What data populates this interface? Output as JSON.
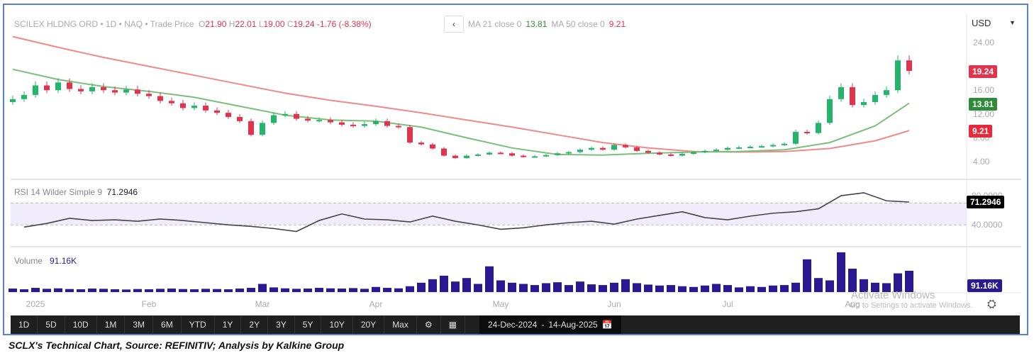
{
  "header": {
    "title": "SCILEX HLDNG ORD",
    "interval": "1D",
    "exchange": "NAQ",
    "price_type": "Trade Price",
    "open_label": "O",
    "open": "21.90",
    "high_label": "H",
    "high": "22.01",
    "low_label": "L",
    "low": "19.00",
    "close_label": "C",
    "close": "19.24",
    "change": "-1.76 (-8.38%)"
  },
  "ma_legend": {
    "ma21_label": "MA 21 close 0",
    "ma21_value": "13.81",
    "ma50_label": "MA 50 close 0",
    "ma50_value": "9.21"
  },
  "currency": "USD",
  "rsi_legend": {
    "label": "RSI 14 Wilder Simple 9",
    "value": "71.2946"
  },
  "volume_legend": {
    "label": "Volume",
    "value": "91.16K"
  },
  "tags": {
    "last_price": "19.24",
    "ma21": "13.81",
    "ma50": "9.21",
    "rsi": "71.2946",
    "volume": "91.16K"
  },
  "colors": {
    "up": "#26b36b",
    "down": "#e0344e",
    "ma21": "#7bbf7b",
    "ma50": "#f08a8a",
    "rsi": "#444444",
    "volume": "#2b1a8f",
    "rsi_band": "#f1ecfb"
  },
  "toolbar": {
    "ranges": [
      "1D",
      "5D",
      "10D",
      "1M",
      "3M",
      "6M",
      "YTD",
      "1Y",
      "2Y",
      "3Y",
      "5Y",
      "10Y",
      "20Y",
      "Max"
    ],
    "date_from": "24-Dec-2024",
    "date_sep": "-",
    "date_to": "14-Aug-2025"
  },
  "watermark": {
    "line1": "Activate Windows",
    "line2": "Go to Settings to activate Windows."
  },
  "caption": "SCLX's Technical Chart, Source: REFINITIV; Analysis by Kalkine Group",
  "chart_data": {
    "type": "candlestick",
    "price_axis": {
      "ticks": [
        "24.00",
        "16.00",
        "12.00",
        "8.00",
        "4.00"
      ],
      "tick_values": [
        24,
        16,
        12,
        8,
        4
      ],
      "range": [
        2,
        26
      ]
    },
    "rsi_axis": {
      "ticks": [
        "80.0000",
        "40.0000"
      ],
      "tick_values": [
        80,
        40
      ],
      "band": [
        40,
        70
      ],
      "range": [
        25,
        90
      ]
    },
    "x_labels": [
      {
        "label": "2025",
        "index": 2
      },
      {
        "label": "Feb",
        "index": 12
      },
      {
        "label": "Mar",
        "index": 22
      },
      {
        "label": "Apr",
        "index": 32
      },
      {
        "label": "May",
        "index": 43
      },
      {
        "label": "Jun",
        "index": 53
      },
      {
        "label": "Jul",
        "index": 63
      },
      {
        "label": "Aug",
        "index": 74
      }
    ],
    "close": [
      14.5,
      15.2,
      16.8,
      16.0,
      17.3,
      16.2,
      15.8,
      16.5,
      16.0,
      15.6,
      16.1,
      15.4,
      15.0,
      14.2,
      13.8,
      13.0,
      13.4,
      12.6,
      12.2,
      11.5,
      10.8,
      8.5,
      10.5,
      11.8,
      12.0,
      11.2,
      10.9,
      11.0,
      10.6,
      10.2,
      10.0,
      10.3,
      10.8,
      10.0,
      9.8,
      7.2,
      6.9,
      6.2,
      5.0,
      4.6,
      5.0,
      5.2,
      5.5,
      5.4,
      5.0,
      4.8,
      4.9,
      5.1,
      5.4,
      5.6,
      6.0,
      6.3,
      6.0,
      6.8,
      6.4,
      5.8,
      5.5,
      5.2,
      5.0,
      5.3,
      5.6,
      5.8,
      6.0,
      6.3,
      6.4,
      6.5,
      6.6,
      6.8,
      7.0,
      9.0,
      8.8,
      10.5,
      14.5,
      16.5,
      13.5,
      14.0,
      15.2,
      16.0,
      21.0,
      19.24
    ],
    "first_open": 14.0,
    "ma21_every4": [
      19.5,
      17.8,
      16.6,
      15.8,
      14.8,
      13.3,
      11.8,
      11.0,
      10.8,
      9.8,
      8.0,
      6.3,
      5.2,
      5.1,
      5.4,
      5.6,
      5.7,
      6.0,
      7.2,
      10.0,
      13.81
    ],
    "ma50_every4": [
      25.0,
      23.2,
      21.5,
      20.0,
      18.5,
      17.0,
      15.5,
      14.3,
      13.3,
      12.2,
      11.0,
      9.8,
      8.5,
      7.2,
      6.3,
      5.7,
      5.6,
      5.7,
      6.2,
      7.5,
      9.21
    ],
    "rsi_every2": [
      37,
      42,
      49,
      46,
      47,
      45,
      48,
      46,
      43,
      40,
      38,
      35,
      31,
      46,
      55,
      48,
      47,
      44,
      52,
      45,
      40,
      34,
      36,
      40,
      43,
      45,
      41,
      48,
      53,
      58,
      50,
      47,
      52,
      56,
      58,
      62,
      80,
      84,
      73,
      71.2946
    ],
    "volume_k": [
      15,
      12,
      18,
      14,
      16,
      13,
      12,
      15,
      14,
      12,
      11,
      13,
      12,
      14,
      15,
      13,
      12,
      14,
      13,
      12,
      15,
      18,
      35,
      20,
      16,
      14,
      15,
      18,
      16,
      15,
      17,
      14,
      22,
      18,
      16,
      25,
      40,
      55,
      70,
      45,
      60,
      35,
      110,
      50,
      40,
      35,
      30,
      38,
      42,
      30,
      45,
      33,
      30,
      40,
      55,
      38,
      32,
      28,
      30,
      25,
      22,
      28,
      35,
      30,
      20,
      25,
      22,
      28,
      30,
      40,
      140,
      60,
      50,
      170,
      100,
      55,
      40,
      38,
      80,
      91.16
    ]
  }
}
